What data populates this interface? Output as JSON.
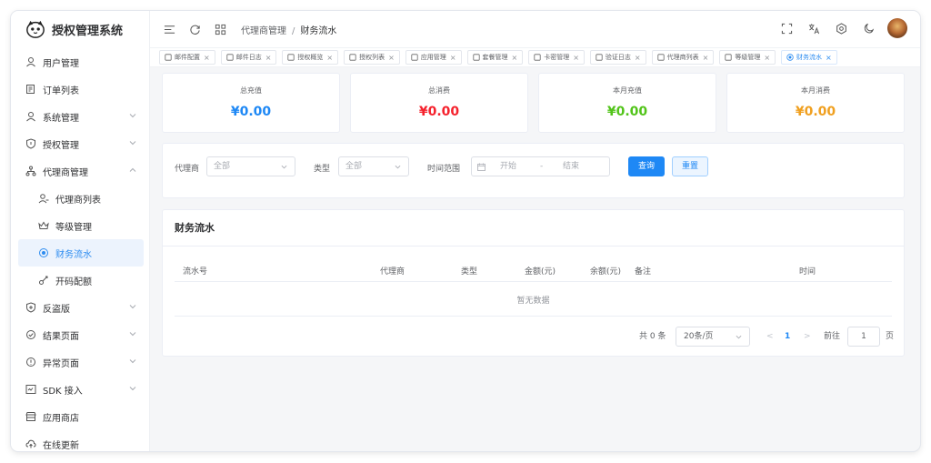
{
  "app": {
    "title": "授权管理系统"
  },
  "sidebar": {
    "items": [
      {
        "label": "用户管理",
        "icon": "user-icon",
        "expandable": false
      },
      {
        "label": "订单列表",
        "icon": "order-list-icon",
        "expandable": false
      },
      {
        "label": "系统管理",
        "icon": "user-icon",
        "expandable": true
      },
      {
        "label": "授权管理",
        "icon": "shield-icon",
        "expandable": true
      },
      {
        "label": "代理商管理",
        "icon": "org-tree-icon",
        "expandable": true,
        "expanded": true
      },
      {
        "label": "代理商列表",
        "icon": "user-group-icon",
        "sub": true
      },
      {
        "label": "等级管理",
        "icon": "crown-icon",
        "sub": true
      },
      {
        "label": "财务流水",
        "icon": "dot-circle-icon",
        "sub": true,
        "active": true
      },
      {
        "label": "开码配额",
        "icon": "key-icon",
        "sub": true
      },
      {
        "label": "反盗版",
        "icon": "shield-plus-icon",
        "expandable": true
      },
      {
        "label": "结果页面",
        "icon": "check-circle-icon",
        "expandable": true
      },
      {
        "label": "异常页面",
        "icon": "alert-circle-icon",
        "expandable": true
      },
      {
        "label": "SDK 接入",
        "icon": "sdk-icon",
        "expandable": true
      },
      {
        "label": "应用商店",
        "icon": "store-icon",
        "expandable": false
      },
      {
        "label": "在线更新",
        "icon": "cloud-upload-icon",
        "expandable": false
      }
    ]
  },
  "header": {
    "breadcrumb": [
      "代理商管理",
      "财务流水"
    ],
    "breadcrumb_sep": "/"
  },
  "tabs": [
    {
      "label": "邮件配置",
      "icon": "mail-config-icon"
    },
    {
      "label": "邮件日志",
      "icon": "mail-icon"
    },
    {
      "label": "授权概览",
      "icon": "grid-icon"
    },
    {
      "label": "授权列表",
      "icon": "list-icon"
    },
    {
      "label": "应用管理",
      "icon": "apps-icon"
    },
    {
      "label": "套餐管理",
      "icon": "tag-icon"
    },
    {
      "label": "卡密管理",
      "icon": "card-icon"
    },
    {
      "label": "验证日志",
      "icon": "doc-icon"
    },
    {
      "label": "代理商列表",
      "icon": "user-group-icon"
    },
    {
      "label": "等级管理",
      "icon": "crown-icon"
    },
    {
      "label": "财务流水",
      "icon": "dot-circle-icon",
      "active": true
    }
  ],
  "tab_close": "×",
  "stats": [
    {
      "label": "总充值",
      "value": "¥0.00",
      "color": "#1e88f5"
    },
    {
      "label": "总消费",
      "value": "¥0.00",
      "color": "#f5222d"
    },
    {
      "label": "本月充值",
      "value": "¥0.00",
      "color": "#52c41a"
    },
    {
      "label": "本月消费",
      "value": "¥0.00",
      "color": "#f0a020"
    }
  ],
  "filter": {
    "agent_label": "代理商",
    "agent_value": "全部",
    "type_label": "类型",
    "type_value": "全部",
    "range_label": "时间范围",
    "range_start": "开始",
    "range_sep": "-",
    "range_end": "结束",
    "query_button": "查询",
    "reset_button": "重置"
  },
  "table": {
    "title": "财务流水",
    "columns": [
      "流水号",
      "代理商",
      "类型",
      "金额(元)",
      "余额(元)",
      "备注",
      "时间"
    ],
    "empty_text": "暂无数据"
  },
  "pagination": {
    "total_text": "共 0 条",
    "page_size": "20条/页",
    "prev": "<",
    "current_page": "1",
    "next": ">",
    "goto_label": "前往",
    "goto_value": "1",
    "page_suffix": "页"
  },
  "colors": {
    "accent": "#2d8cf0",
    "primary_button": "#1e88f5"
  }
}
